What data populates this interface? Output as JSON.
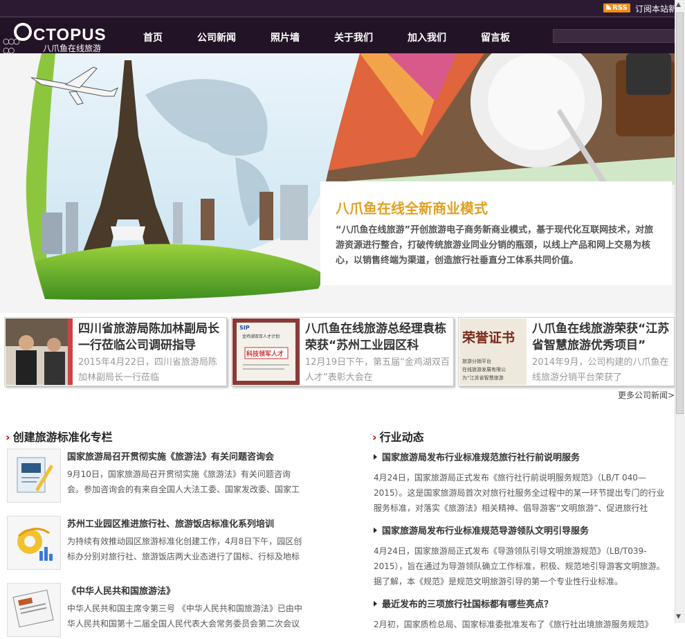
{
  "topbar": {
    "rss_label": "RSS",
    "subscribe": "订阅本站新闻"
  },
  "logo": {
    "word": "CTOPUS",
    "slogan": "八爪鱼在线旅游"
  },
  "nav": [
    {
      "label": "首页"
    },
    {
      "label": "公司新闻"
    },
    {
      "label": "照片墙"
    },
    {
      "label": "关于我们"
    },
    {
      "label": "加入我们"
    },
    {
      "label": "留言板"
    }
  ],
  "banner": {
    "title": "八爪鱼在线全新商业模式",
    "desc": "“八爪鱼在线旅游”开创旅游电子商务新商业模式，基于现代化互联网技术，对旅游资源进行整合，打破传统旅游业同业分销的瓶颈，以线上产品和网上交易为核心，以销售终端为渠道，创造旅行社垂直分工体系共同价值。"
  },
  "news_cards": [
    {
      "title": "四川省旅游局陈加林副局长一行莅临公司调研指导",
      "summary": "2015年4月22日，四川省旅游局陈加林副局长一行莅临"
    },
    {
      "title": "八爪鱼在线旅游总经理袁栋荣获“苏州工业园区科",
      "summary": "12月19日下午，第五届“金鸡湖双百人才”表彰大会在"
    },
    {
      "title": "八爪鱼在线旅游荣获“江苏省智慧旅游优秀项目”",
      "summary": "2014年9月，公司构建的八爪鱼在线旅游分销平台荣获了"
    }
  ],
  "card_images": [
    {
      "caption": ""
    },
    {
      "badge": "SIP",
      "line1": "金鸡湖双百人才计划",
      "line2": "科技领军人才"
    },
    {
      "heading": "荣誉证书",
      "line1": "旅游分销平台",
      "line2": "在线旅游发展有限公",
      "line3": "为“江苏省智慧旅游"
    }
  ],
  "more_news": "更多公司新闻>",
  "standards": {
    "title": "创建旅游标准化专栏",
    "items": [
      {
        "title": "国家旅游局召开贯彻实施《旅游法》有关问题咨询会",
        "desc": "9月10日，国家旅游局召开贯彻实施《旅游法》有关问题咨询会。参加咨询会的有来自全国人大法工委、国家发改委、国家工"
      },
      {
        "title": "苏州工业园区推进旅行社、旅游饭店标准化系列培训",
        "desc": "为持续有效推动园区旅游标准化创建工作，4月8日下午，园区创标办分别对旅行社、旅游饭店两大业态进行了国标、行标及地标"
      },
      {
        "title": "《中华人民共和国旅游法》",
        "desc": "中华人民共和国主席令第三号 《中华人民共和国旅游法》已由中华人民共和国第十二届全国人民代表大会常务委员会第二次会议"
      }
    ]
  },
  "industry": {
    "title": "行业动态",
    "items": [
      {
        "title": "国家旅游局发布行业标准规范旅行社行前说明服务",
        "desc": "4月24日，国家旅游局正式发布《旅行社行前说明服务规范》（LB/T 040—2015）。这是国家旅游局首次对旅行社服务全过程中的某一环节提出专门的行业服务标准，对落实《旅游法》相关精神、倡导游客“文明旅游”、促进旅行社"
      },
      {
        "title": "国家旅游局发布行业标准规范导游领队文明引导服务",
        "desc": "4月24日，国家旅游局正式发布《导游领队引导文明旅游规范》（LB/T039-2015），旨在通过为导游领队确立工作标准，积极、规范地引导游客文明旅游。据了解，本《规范》是规范文明旅游引导的第一个专业性行业标准。"
      },
      {
        "title": "最近发布的三项旅行社国标都有哪些亮点？",
        "desc": "2月初，国家质检总局、国家标准委批准发布了《旅行社出境旅游服务规范》"
      }
    ]
  },
  "colors": {
    "topbar": "#2c1a33",
    "header": "#231326",
    "accent_title": "#e0a020",
    "rss": "#f28c1b"
  }
}
